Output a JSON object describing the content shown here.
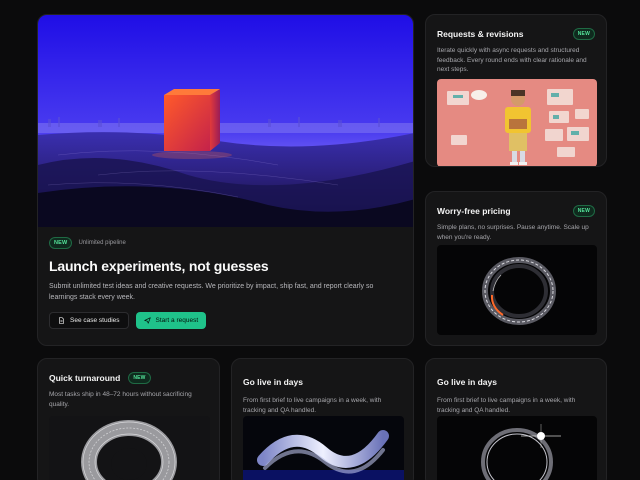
{
  "hero": {
    "badge": "NEW",
    "meta": "Unlimited pipeline",
    "title": "Launch experiments, not guesses",
    "description": "Submit unlimited test ideas and creative requests. We prioritize by impact, ship fast, and report clearly so learnings stack every week.",
    "btn_case": "See case studies",
    "btn_start": "Start a request"
  },
  "requests": {
    "title": "Requests & revisions",
    "badge": "NEW",
    "description": "Iterate quickly with async requests and structured feedback. Every round ends with clear rationale and next steps."
  },
  "pricing": {
    "title": "Worry-free pricing",
    "badge": "NEW",
    "description": "Simple plans, no surprises. Pause anytime. Scale up when you're ready."
  },
  "quick": {
    "title": "Quick turnaround",
    "badge": "NEW",
    "description": "Most tasks ship in 48–72 hours without sacrificing quality."
  },
  "live1": {
    "title": "Go live in days",
    "description": "From first brief to live campaigns in a week, with tracking and QA handled."
  },
  "live2": {
    "title": "Go live in days",
    "description": "From first brief to live campaigns in a week, with tracking and QA handled."
  },
  "colors": {
    "accent": "#1fc28a",
    "badge_text": "#54e39a"
  }
}
